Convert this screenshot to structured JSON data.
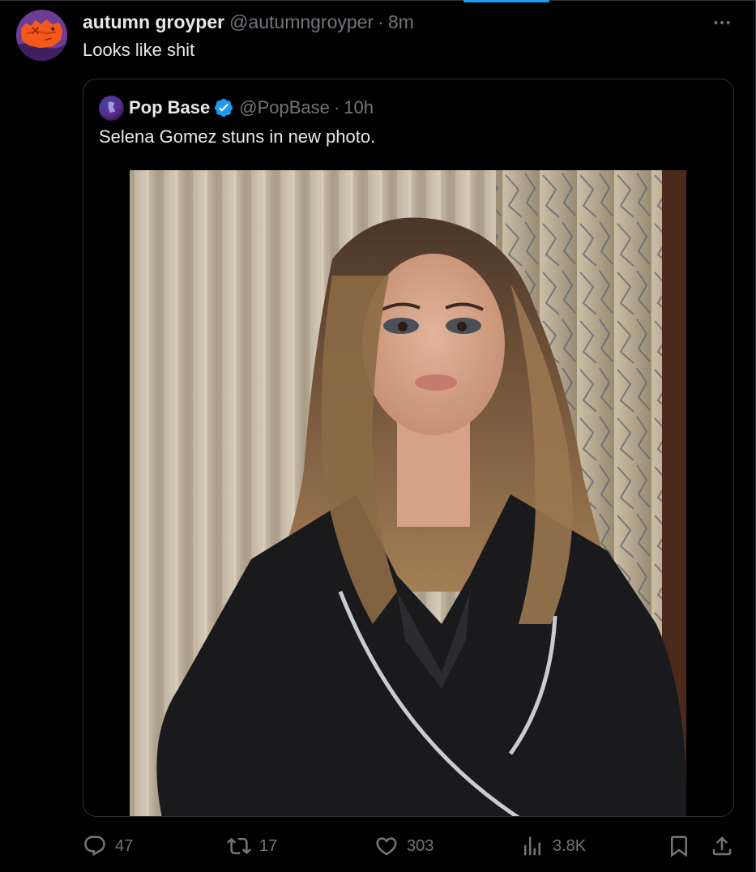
{
  "colors": {
    "background": "#000000",
    "text_primary": "#e7e9ea",
    "text_secondary": "#71767b",
    "border": "#2f3336",
    "accent": "#1d9bf0"
  },
  "tweet": {
    "display_name": "autumn groyper",
    "handle": "@autumngroyper",
    "separator": "·",
    "time": "8m",
    "text": "Looks like shit",
    "avatar_icon": "orange-frog-avatar",
    "more_icon": "more-horizontal-icon"
  },
  "quoted_tweet": {
    "display_name": "Pop Base",
    "verified": true,
    "verified_icon": "verified-badge-icon",
    "handle": "@PopBase",
    "separator": "·",
    "time": "10h",
    "text": "Selena Gomez stuns in new photo.",
    "media_icon": "photo-woman-black-blazer"
  },
  "actions": {
    "reply": {
      "icon": "reply-icon",
      "count": "47"
    },
    "retweet": {
      "icon": "retweet-icon",
      "count": "17"
    },
    "like": {
      "icon": "heart-icon",
      "count": "303"
    },
    "views": {
      "icon": "views-chart-icon",
      "count": "3.8K"
    },
    "bookmark": {
      "icon": "bookmark-icon"
    },
    "share": {
      "icon": "share-icon"
    }
  }
}
